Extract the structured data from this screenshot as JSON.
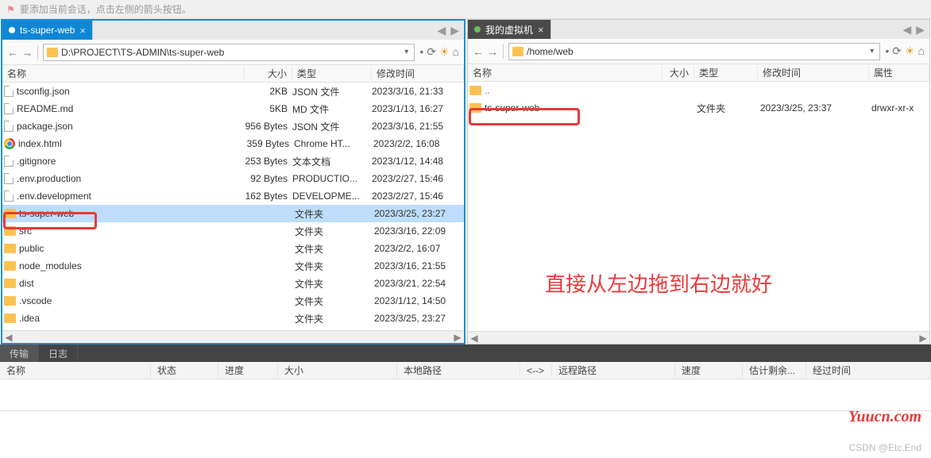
{
  "hint": "要添加当前会话，点击左侧的箭头按钮。",
  "left": {
    "tab": "ts-super-web",
    "path": "D:\\PROJECT\\TS-ADMIN\\ts-super-web",
    "columns": {
      "name": "名称",
      "size": "大小",
      "type": "类型",
      "modified": "修改时间"
    },
    "rows": [
      {
        "icon": "file",
        "name": "tsconfig.json",
        "size": "2KB",
        "type": "JSON 文件",
        "modified": "2023/3/16, 21:33"
      },
      {
        "icon": "file",
        "name": "README.md",
        "size": "5KB",
        "type": "MD 文件",
        "modified": "2023/1/13, 16:27"
      },
      {
        "icon": "file",
        "name": "package.json",
        "size": "956 Bytes",
        "type": "JSON 文件",
        "modified": "2023/3/16, 21:55"
      },
      {
        "icon": "chrome",
        "name": "index.html",
        "size": "359 Bytes",
        "type": "Chrome HT...",
        "modified": "2023/2/2, 16:08"
      },
      {
        "icon": "file",
        "name": ".gitignore",
        "size": "253 Bytes",
        "type": "文本文档",
        "modified": "2023/1/12, 14:48"
      },
      {
        "icon": "file",
        "name": ".env.production",
        "size": "92 Bytes",
        "type": "PRODUCTIO...",
        "modified": "2023/2/27, 15:46"
      },
      {
        "icon": "file",
        "name": ".env.development",
        "size": "162 Bytes",
        "type": "DEVELOPME...",
        "modified": "2023/2/27, 15:46"
      },
      {
        "icon": "folder",
        "name": "ts-super-web",
        "size": "",
        "type": "文件夹",
        "modified": "2023/3/25, 23:27",
        "selected": true
      },
      {
        "icon": "folder",
        "name": "src",
        "size": "",
        "type": "文件夹",
        "modified": "2023/3/16, 22:09"
      },
      {
        "icon": "folder",
        "name": "public",
        "size": "",
        "type": "文件夹",
        "modified": "2023/2/2, 16:07"
      },
      {
        "icon": "folder",
        "name": "node_modules",
        "size": "",
        "type": "文件夹",
        "modified": "2023/3/16, 21:55"
      },
      {
        "icon": "folder",
        "name": "dist",
        "size": "",
        "type": "文件夹",
        "modified": "2023/3/21, 22:54"
      },
      {
        "icon": "folder",
        "name": ".vscode",
        "size": "",
        "type": "文件夹",
        "modified": "2023/1/12, 14:50"
      },
      {
        "icon": "folder",
        "name": ".idea",
        "size": "",
        "type": "文件夹",
        "modified": "2023/3/25, 23:27"
      }
    ]
  },
  "right": {
    "tab": "我的虚拟机",
    "path": "/home/web",
    "columns": {
      "name": "名称",
      "size": "大小",
      "type": "类型",
      "modified": "修改时间",
      "attr": "属性"
    },
    "parent": "..",
    "rows": [
      {
        "icon": "folder",
        "name": "ts-super-web",
        "size": "",
        "type": "文件夹",
        "modified": "2023/3/25, 23:37",
        "attr": "drwxr-xr-x"
      }
    ]
  },
  "annotation": "直接从左边拖到右边就好",
  "bottomTabs": {
    "transfer": "传输",
    "log": "日志"
  },
  "bottomCols": {
    "name": "名称",
    "status": "状态",
    "progress": "进度",
    "size": "大小",
    "local": "本地路径",
    "arrow": "<-->",
    "remote": "远程路径",
    "speed": "速度",
    "eta": "估计剩余...",
    "elapsed": "经过时间"
  },
  "watermark": "Yuucn.com",
  "credit": "CSDN @Etc.End"
}
